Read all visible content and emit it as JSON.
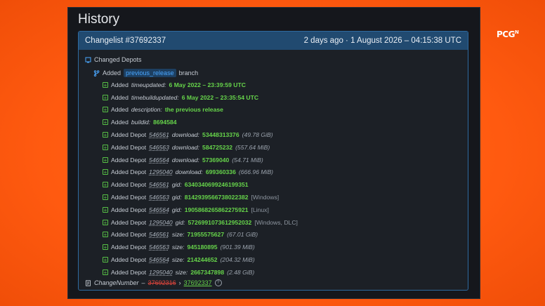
{
  "page": {
    "title": "History"
  },
  "brand": {
    "logo_text": "PCG",
    "logo_sup": "N"
  },
  "changelist": {
    "title": "Changelist #37692337",
    "timestamp": "2 days ago · 1 August 2026 – 04:15:38 UTC",
    "section_label": "Changed Depots",
    "branch": {
      "prefix": "Added",
      "name": "previous_release",
      "suffix": "branch"
    },
    "entries": [
      {
        "action": "Added",
        "field": "timeupdated:",
        "value": "6 May 2022 – 23:39:59 UTC"
      },
      {
        "action": "Added",
        "field": "timebuildupdated:",
        "value": "6 May 2022 – 23:35:54 UTC"
      },
      {
        "action": "Added",
        "field": "description:",
        "value": "the previous release"
      },
      {
        "action": "Added",
        "field": "buildid:",
        "value": "8694584"
      },
      {
        "action": "Added Depot",
        "depot": "546561",
        "field": "download:",
        "value": "53448313376",
        "extra": "(49.78 GiB)"
      },
      {
        "action": "Added Depot",
        "depot": "546563",
        "field": "download:",
        "value": "584725232",
        "extra": "(557.64 MiB)"
      },
      {
        "action": "Added Depot",
        "depot": "546564",
        "field": "download:",
        "value": "57369040",
        "extra": "(54.71 MiB)"
      },
      {
        "action": "Added Depot",
        "depot": "1295040",
        "field": "download:",
        "value": "699360336",
        "extra": "(666.96 MiB)"
      },
      {
        "action": "Added Depot",
        "depot": "546561",
        "field": "gid:",
        "value": "6340340699246199351"
      },
      {
        "action": "Added Depot",
        "depot": "546563",
        "field": "gid:",
        "value": "8142939566738022382",
        "tag": "[Windows]"
      },
      {
        "action": "Added Depot",
        "depot": "546564",
        "field": "gid:",
        "value": "1905868265862275921",
        "tag": "[Linux]"
      },
      {
        "action": "Added Depot",
        "depot": "1295040",
        "field": "gid:",
        "value": "5726991073612952032",
        "tag": "[Windows, DLC]"
      },
      {
        "action": "Added Depot",
        "depot": "546561",
        "field": "size:",
        "value": "71955575627",
        "extra": "(67.01 GiB)"
      },
      {
        "action": "Added Depot",
        "depot": "546563",
        "field": "size:",
        "value": "945180895",
        "extra": "(901.39 MiB)"
      },
      {
        "action": "Added Depot",
        "depot": "546564",
        "field": "size:",
        "value": "214244652",
        "extra": "(204.32 MiB)"
      },
      {
        "action": "Added Depot",
        "depot": "1295040",
        "field": "size:",
        "value": "2667347898",
        "extra": "(2.48 GiB)"
      }
    ],
    "footer": {
      "label": "ChangeNumber",
      "dash": "–",
      "old_value": "37692316",
      "arrow": "›",
      "new_value": "37692337",
      "help": "?"
    }
  }
}
